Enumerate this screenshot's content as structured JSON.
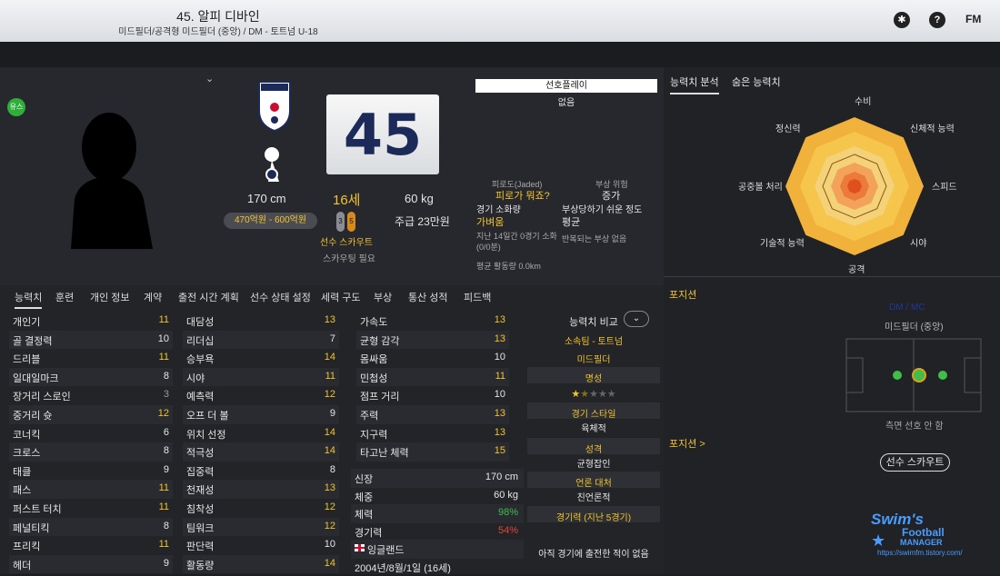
{
  "header": {
    "name": "45. 알피 디바인",
    "role": "미드필더/공격형 미드필더 (중앙) / DM - 토트넘 U-18",
    "icons": [
      "bulb-icon",
      "help-icon"
    ],
    "logo": "FM"
  },
  "profile": {
    "badge": "유스",
    "height": "170 cm",
    "age": "16세",
    "weight": "60 kg",
    "value": "470억원 - 600억원",
    "wage": "주급 23만원",
    "number": "45",
    "scout_label": "선수 스카우트",
    "scout_value": "스카우팅 필요",
    "pips": [
      "3",
      "5"
    ]
  },
  "status": {
    "favorite_label": "선호플레이",
    "favorite_value": "없음",
    "fatigue_label": "피로도(Jaded)",
    "fatigue_value": "피로가 뭐죠?",
    "injury_label": "부상 위험",
    "injury_value": "증가",
    "match_load_label": "경기 소화량",
    "match_load_value": "가벼움",
    "proneness_label": "부상당하기 쉬운 정도",
    "proneness_value": "평균",
    "load_note": "지난 14일간 0경기 소화(0/0분)",
    "recurring": "반복되는 부상 없음",
    "avg_distance": "평균 활동량 0.0km"
  },
  "tabs": [
    "능력치",
    "훈련",
    "개인 정보",
    "계약",
    "출전 시간 계획",
    "선수 상태 설정",
    "세력 구도",
    "부상",
    "통산 성적",
    "피드백"
  ],
  "attrs_tech": [
    [
      "개인기",
      "11"
    ],
    [
      "골 결정력",
      "10"
    ],
    [
      "드리블",
      "11"
    ],
    [
      "일대일마크",
      "8"
    ],
    [
      "장거리 스로인",
      "3"
    ],
    [
      "중거리 슛",
      "12"
    ],
    [
      "코너킥",
      "6"
    ],
    [
      "크로스",
      "8"
    ],
    [
      "태클",
      "9"
    ],
    [
      "패스",
      "11"
    ],
    [
      "퍼스트 터치",
      "11"
    ],
    [
      "페널티킥",
      "8"
    ],
    [
      "프리킥",
      "11"
    ],
    [
      "헤더",
      "9"
    ]
  ],
  "attrs_mental": [
    [
      "대담성",
      "13"
    ],
    [
      "리더십",
      "7"
    ],
    [
      "승부욕",
      "14"
    ],
    [
      "시야",
      "11"
    ],
    [
      "예측력",
      "12"
    ],
    [
      "오프 더 볼",
      "9"
    ],
    [
      "위치 선정",
      "14"
    ],
    [
      "적극성",
      "14"
    ],
    [
      "집중력",
      "8"
    ],
    [
      "천재성",
      "13"
    ],
    [
      "침착성",
      "12"
    ],
    [
      "팀워크",
      "12"
    ],
    [
      "판단력",
      "10"
    ],
    [
      "활동량",
      "14"
    ]
  ],
  "attrs_phys": [
    [
      "가속도",
      "13"
    ],
    [
      "균형 감각",
      "13"
    ],
    [
      "몸싸움",
      "10"
    ],
    [
      "민첩성",
      "11"
    ],
    [
      "점프 거리",
      "10"
    ],
    [
      "주력",
      "13"
    ],
    [
      "지구력",
      "13"
    ],
    [
      "타고난 체력",
      "15"
    ]
  ],
  "bio": [
    [
      "신장",
      "170 cm"
    ],
    [
      "체중",
      "60 kg"
    ],
    [
      "체력",
      "98%"
    ],
    [
      "경기력",
      "54%"
    ],
    [
      "잉글랜드",
      ""
    ],
    [
      "2004년/8월/1일 (16세)",
      ""
    ]
  ],
  "compare": {
    "title": "능력치 비교",
    "club": "소속팀 - 토트넘",
    "position": "미드필더",
    "rep_label": "명성",
    "style_label": "경기 스타일",
    "style_value": "육체적",
    "personality_label": "성격",
    "personality_value": "균형잡인",
    "media_label": "언론 대처",
    "media_value": "친언론적",
    "form_label": "경기력 (지난 5경기)",
    "form_value": "아직 경기에 출전한 적이 없음"
  },
  "radar": {
    "tabs": [
      "능력치 분석",
      "숨은 능력치"
    ],
    "labels": [
      "수비",
      "신체적 능력",
      "스피드",
      "시야",
      "공격",
      "기술적 능력",
      "공중볼 처리",
      "정신력"
    ]
  },
  "position": {
    "title": "포지션",
    "role": "미드필더 (중앙)",
    "tag": "DM / MC",
    "note": "측면 선호 안 함",
    "title2": "포지션 >",
    "scout_button": "선수 스카우트"
  },
  "watermark": {
    "line1": "Swim's",
    "line2": "Football",
    "line3": "MANAGER",
    "url": "https://swimfm.tistory.com/"
  },
  "colors": {
    "gold": "#f2c42f",
    "green": "#3fbf4a",
    "red": "#e0463a"
  }
}
